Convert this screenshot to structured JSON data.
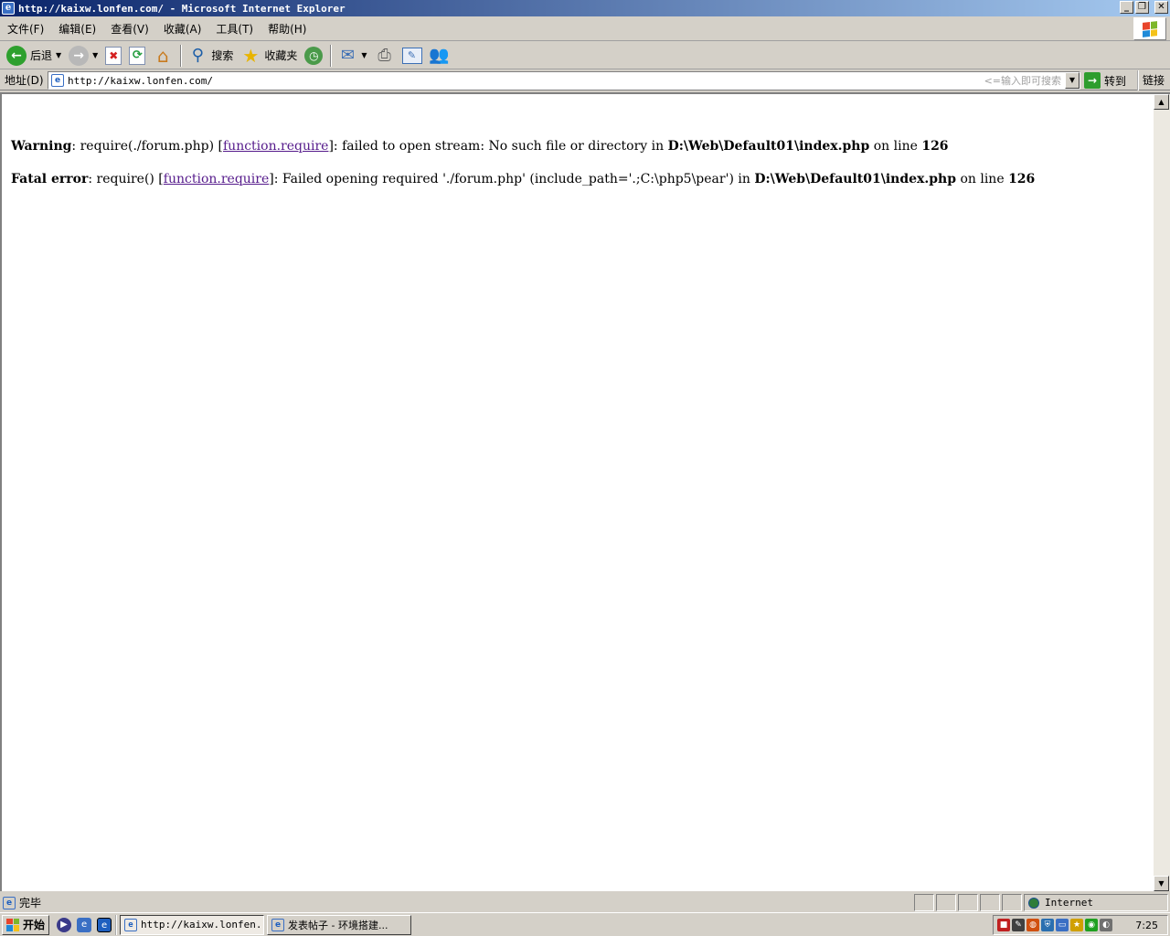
{
  "window": {
    "title": "http://kaixw.lonfen.com/ - Microsoft Internet Explorer",
    "controls": {
      "minimize": "_",
      "restore": "❐",
      "close": "✕"
    }
  },
  "menu": [
    "文件(F)",
    "编辑(E)",
    "查看(V)",
    "收藏(A)",
    "工具(T)",
    "帮助(H)"
  ],
  "toolbar": {
    "back_label": "后退",
    "search_label": "搜索",
    "favorites_label": "收藏夹"
  },
  "address": {
    "label": "地址(D)",
    "url": "http://kaixw.lonfen.com/",
    "search_hint": "<=输入即可搜索",
    "go_label": "转到",
    "links_label": "链接"
  },
  "content": {
    "warning": {
      "label": "Warning",
      "text1": ": require(./forum.php) [",
      "link": "function.require",
      "text2": "]: failed to open stream: No such file or directory in ",
      "path": "D:\\Web\\Default01\\index.php",
      "text3": " on line ",
      "line": "126"
    },
    "fatal": {
      "label": "Fatal error",
      "text1": ": require() [",
      "link": "function.require",
      "text2": "]: Failed opening required './forum.php' (include_path='.;C:\\php5\\pear') in ",
      "path": "D:\\Web\\Default01\\index.php",
      "text3": " on line ",
      "line": "126"
    }
  },
  "status": {
    "text": "完毕",
    "zone": "Internet"
  },
  "taskbar": {
    "start_label": "开始",
    "tasks": [
      {
        "label": "http://kaixw.lonfen..."
      },
      {
        "label": "发表帖子 - 环境搭建..."
      }
    ],
    "clock": "7:25"
  },
  "colors": {
    "titlebar_start": "#0a246a",
    "titlebar_end": "#a6caf0",
    "chrome": "#d4d0c8",
    "visited_link": "#551a8b"
  }
}
